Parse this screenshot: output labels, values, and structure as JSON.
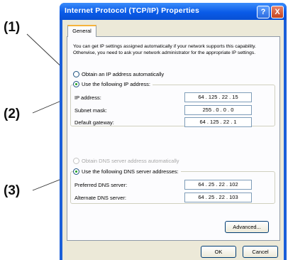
{
  "callouts": [
    "(1)",
    "(2)",
    "(3)"
  ],
  "window": {
    "title": "Internet Protocol (TCP/IP) Properties",
    "help_glyph": "?",
    "close_glyph": "X"
  },
  "tab": "General",
  "description": "You can get IP settings assigned automatically if your network supports this capability. Otherwise, you need to ask your network administrator for the appropriate IP settings.",
  "ip_section": {
    "auto_label": "Obtain an IP address automatically",
    "manual_label": "Use the following IP address:",
    "selected": "manual",
    "fields": [
      {
        "label": "IP address:",
        "value": "64 . 125 . 22 . 15"
      },
      {
        "label": "Subnet mask:",
        "value": "255 . 0 . 0 . 0"
      },
      {
        "label": "Default gateway:",
        "value": "64 . 125 . 22 . 1"
      }
    ]
  },
  "dns_section": {
    "auto_label": "Obtain DNS server address automatically",
    "manual_label": "Use the following DNS server addresses:",
    "selected": "manual",
    "fields": [
      {
        "label": "Preferred DNS server:",
        "value": "64 . 25 . 22 . 102"
      },
      {
        "label": "Alternate DNS server:",
        "value": "64 . 25 . 22 . 103"
      }
    ]
  },
  "buttons": {
    "advanced": "Advanced...",
    "ok": "OK",
    "cancel": "Cancel"
  }
}
